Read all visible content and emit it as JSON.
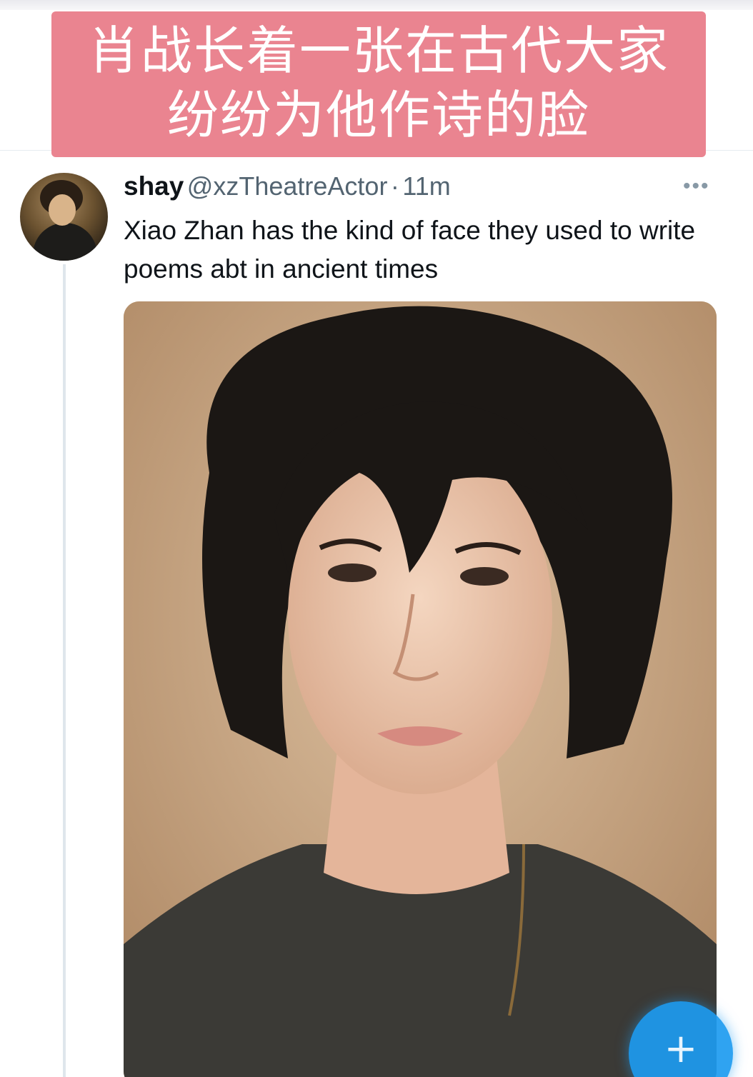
{
  "overlay": {
    "line1": "肖战长着一张在古代大家",
    "line2": "纷纷为他作诗的脸"
  },
  "tweet": {
    "display_name": "shay",
    "handle": "@xzTheatreActor",
    "separator": "·",
    "timestamp": "11m",
    "text": "Xiao Zhan has the kind of face they used to write poems abt in ancient times",
    "more_icon": "more-horizontal-icon",
    "avatar": "user-avatar"
  },
  "compose_button": {
    "icon": "plus-icon",
    "glyph": "+",
    "color": "#1d9bf0"
  },
  "colors": {
    "banner": "#ea8490",
    "text_primary": "#0f1419",
    "text_secondary": "#536471"
  }
}
